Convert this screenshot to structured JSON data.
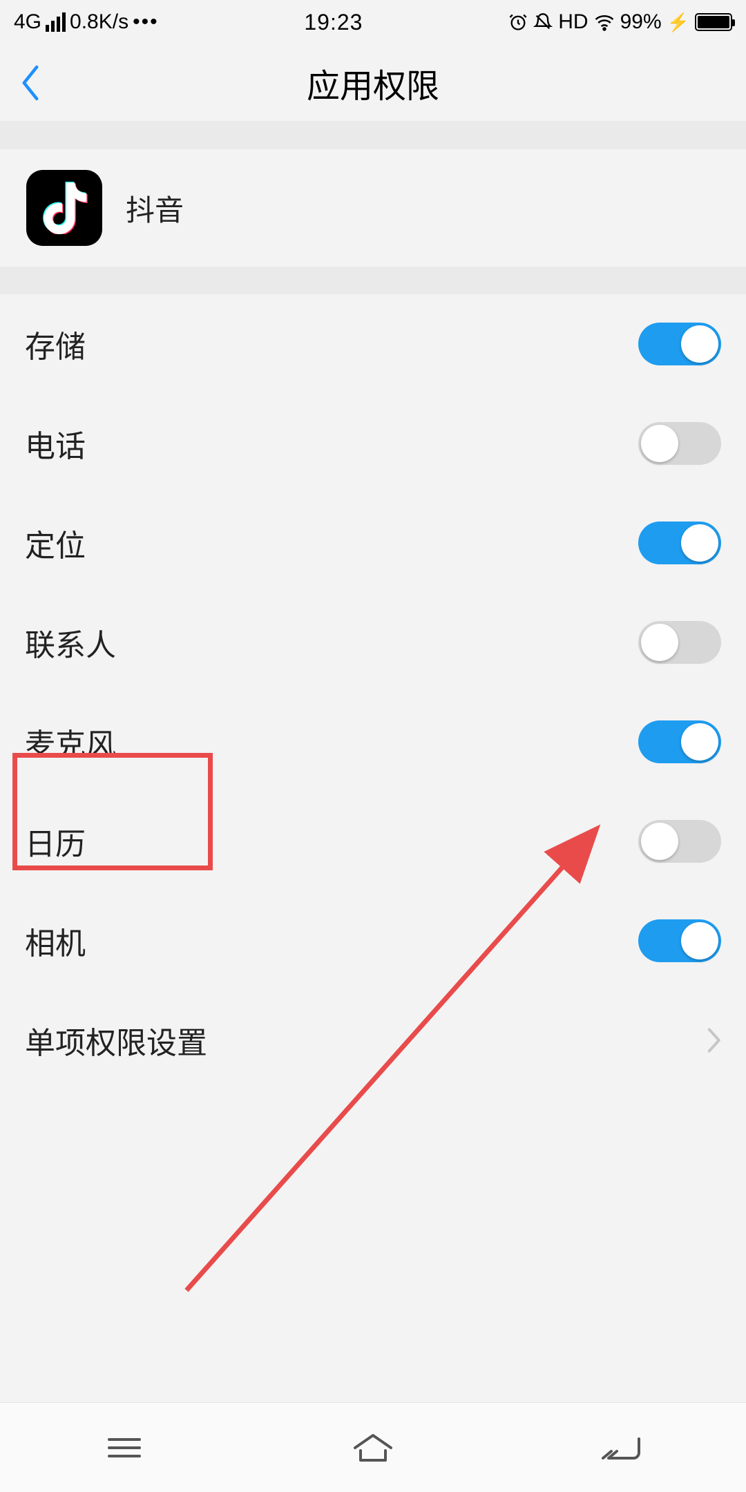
{
  "status": {
    "network_type": "4G",
    "speed": "0.8K/s",
    "time": "19:23",
    "hd": "HD",
    "battery_percent": "99%"
  },
  "header": {
    "title": "应用权限"
  },
  "app": {
    "name": "抖音"
  },
  "permissions": [
    {
      "label": "存储",
      "on": true
    },
    {
      "label": "电话",
      "on": false
    },
    {
      "label": "定位",
      "on": true
    },
    {
      "label": "联系人",
      "on": false
    },
    {
      "label": "麦克风",
      "on": true
    },
    {
      "label": "日历",
      "on": false
    },
    {
      "label": "相机",
      "on": true
    }
  ],
  "single_settings_label": "单项权限设置",
  "annotation": {
    "highlight_permission_index": 4,
    "arrow": true
  }
}
